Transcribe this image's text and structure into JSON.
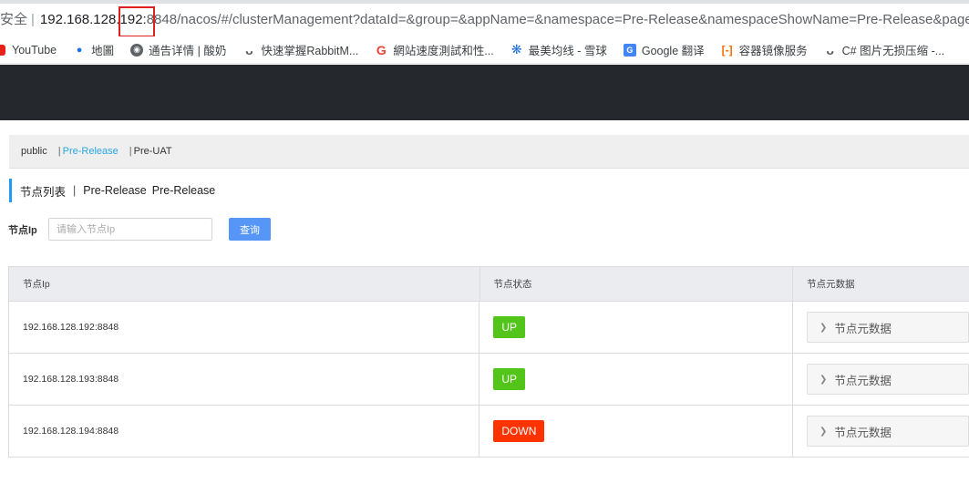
{
  "browser": {
    "security_label": "安全",
    "url_host": "192.168.128.",
    "url_highlight": "192:",
    "url_rest": "8848/nacos/#/clusterManagement?dataId=&group=&appName=&namespace=Pre-Release&namespaceShowName=Pre-Release&page",
    "bookmarks": [
      {
        "label": "YouTube",
        "icon": "youtube-icon"
      },
      {
        "label": "地圖",
        "icon": "map-pin-icon"
      },
      {
        "label": "通告详情 | 酸奶",
        "icon": "globe-icon"
      },
      {
        "label": "快速掌握RabbitM...",
        "icon": "va-icon"
      },
      {
        "label": "網站速度測試和性...",
        "icon": "g-icon"
      },
      {
        "label": "最美均线 - 雪球",
        "icon": "snowball-icon"
      },
      {
        "label": "Google 翻译",
        "icon": "google-translate-icon"
      },
      {
        "label": "容器镜像服务",
        "icon": "aliyun-icon"
      },
      {
        "label": "C# 图片无损压缩 -...",
        "icon": "va-icon"
      }
    ]
  },
  "namespaces": [
    "public",
    "Pre-Release",
    "Pre-UAT"
  ],
  "active_namespace": "Pre-Release",
  "title": {
    "main": "节点列表",
    "divider": "|",
    "ns_name": "Pre-Release",
    "ns_id": "Pre-Release"
  },
  "search": {
    "label": "节点Ip",
    "placeholder": "请输入节点Ip",
    "button": "查询"
  },
  "table": {
    "headers": [
      "节点Ip",
      "节点状态",
      "节点元数据"
    ],
    "rows": [
      {
        "ip": "192.168.128.192:8848",
        "status": "UP",
        "meta": "节点元数据"
      },
      {
        "ip": "192.168.128.193:8848",
        "status": "UP",
        "meta": "节点元数据"
      },
      {
        "ip": "192.168.128.194:8848",
        "status": "DOWN",
        "meta": "节点元数据"
      }
    ]
  },
  "colors": {
    "up": "#52c41a",
    "down": "#ff3300",
    "accent": "#2ba6e0",
    "header_bg": "#25292d"
  }
}
